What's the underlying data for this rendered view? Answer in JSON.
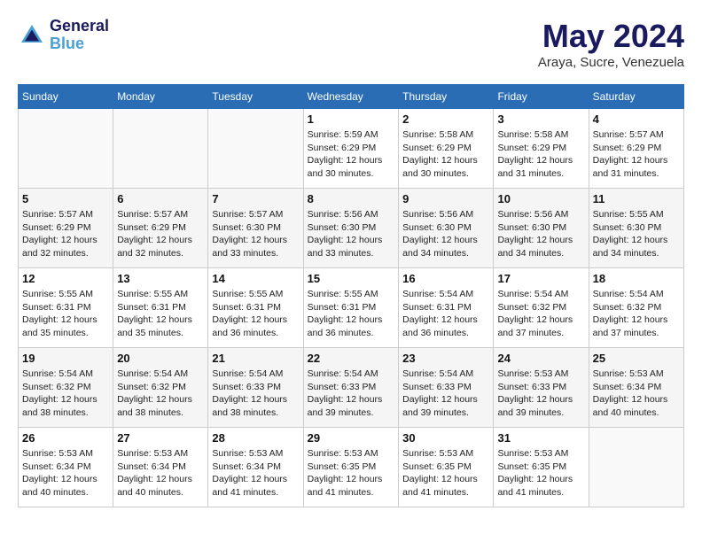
{
  "header": {
    "logo_line1": "General",
    "logo_line2": "Blue",
    "month_year": "May 2024",
    "location": "Araya, Sucre, Venezuela"
  },
  "days_of_week": [
    "Sunday",
    "Monday",
    "Tuesday",
    "Wednesday",
    "Thursday",
    "Friday",
    "Saturday"
  ],
  "weeks": [
    [
      {
        "day": "",
        "sunrise": "",
        "sunset": "",
        "daylight": ""
      },
      {
        "day": "",
        "sunrise": "",
        "sunset": "",
        "daylight": ""
      },
      {
        "day": "",
        "sunrise": "",
        "sunset": "",
        "daylight": ""
      },
      {
        "day": "1",
        "sunrise": "Sunrise: 5:59 AM",
        "sunset": "Sunset: 6:29 PM",
        "daylight": "Daylight: 12 hours and 30 minutes."
      },
      {
        "day": "2",
        "sunrise": "Sunrise: 5:58 AM",
        "sunset": "Sunset: 6:29 PM",
        "daylight": "Daylight: 12 hours and 30 minutes."
      },
      {
        "day": "3",
        "sunrise": "Sunrise: 5:58 AM",
        "sunset": "Sunset: 6:29 PM",
        "daylight": "Daylight: 12 hours and 31 minutes."
      },
      {
        "day": "4",
        "sunrise": "Sunrise: 5:57 AM",
        "sunset": "Sunset: 6:29 PM",
        "daylight": "Daylight: 12 hours and 31 minutes."
      }
    ],
    [
      {
        "day": "5",
        "sunrise": "Sunrise: 5:57 AM",
        "sunset": "Sunset: 6:29 PM",
        "daylight": "Daylight: 12 hours and 32 minutes."
      },
      {
        "day": "6",
        "sunrise": "Sunrise: 5:57 AM",
        "sunset": "Sunset: 6:29 PM",
        "daylight": "Daylight: 12 hours and 32 minutes."
      },
      {
        "day": "7",
        "sunrise": "Sunrise: 5:57 AM",
        "sunset": "Sunset: 6:30 PM",
        "daylight": "Daylight: 12 hours and 33 minutes."
      },
      {
        "day": "8",
        "sunrise": "Sunrise: 5:56 AM",
        "sunset": "Sunset: 6:30 PM",
        "daylight": "Daylight: 12 hours and 33 minutes."
      },
      {
        "day": "9",
        "sunrise": "Sunrise: 5:56 AM",
        "sunset": "Sunset: 6:30 PM",
        "daylight": "Daylight: 12 hours and 34 minutes."
      },
      {
        "day": "10",
        "sunrise": "Sunrise: 5:56 AM",
        "sunset": "Sunset: 6:30 PM",
        "daylight": "Daylight: 12 hours and 34 minutes."
      },
      {
        "day": "11",
        "sunrise": "Sunrise: 5:55 AM",
        "sunset": "Sunset: 6:30 PM",
        "daylight": "Daylight: 12 hours and 34 minutes."
      }
    ],
    [
      {
        "day": "12",
        "sunrise": "Sunrise: 5:55 AM",
        "sunset": "Sunset: 6:31 PM",
        "daylight": "Daylight: 12 hours and 35 minutes."
      },
      {
        "day": "13",
        "sunrise": "Sunrise: 5:55 AM",
        "sunset": "Sunset: 6:31 PM",
        "daylight": "Daylight: 12 hours and 35 minutes."
      },
      {
        "day": "14",
        "sunrise": "Sunrise: 5:55 AM",
        "sunset": "Sunset: 6:31 PM",
        "daylight": "Daylight: 12 hours and 36 minutes."
      },
      {
        "day": "15",
        "sunrise": "Sunrise: 5:55 AM",
        "sunset": "Sunset: 6:31 PM",
        "daylight": "Daylight: 12 hours and 36 minutes."
      },
      {
        "day": "16",
        "sunrise": "Sunrise: 5:54 AM",
        "sunset": "Sunset: 6:31 PM",
        "daylight": "Daylight: 12 hours and 36 minutes."
      },
      {
        "day": "17",
        "sunrise": "Sunrise: 5:54 AM",
        "sunset": "Sunset: 6:32 PM",
        "daylight": "Daylight: 12 hours and 37 minutes."
      },
      {
        "day": "18",
        "sunrise": "Sunrise: 5:54 AM",
        "sunset": "Sunset: 6:32 PM",
        "daylight": "Daylight: 12 hours and 37 minutes."
      }
    ],
    [
      {
        "day": "19",
        "sunrise": "Sunrise: 5:54 AM",
        "sunset": "Sunset: 6:32 PM",
        "daylight": "Daylight: 12 hours and 38 minutes."
      },
      {
        "day": "20",
        "sunrise": "Sunrise: 5:54 AM",
        "sunset": "Sunset: 6:32 PM",
        "daylight": "Daylight: 12 hours and 38 minutes."
      },
      {
        "day": "21",
        "sunrise": "Sunrise: 5:54 AM",
        "sunset": "Sunset: 6:33 PM",
        "daylight": "Daylight: 12 hours and 38 minutes."
      },
      {
        "day": "22",
        "sunrise": "Sunrise: 5:54 AM",
        "sunset": "Sunset: 6:33 PM",
        "daylight": "Daylight: 12 hours and 39 minutes."
      },
      {
        "day": "23",
        "sunrise": "Sunrise: 5:54 AM",
        "sunset": "Sunset: 6:33 PM",
        "daylight": "Daylight: 12 hours and 39 minutes."
      },
      {
        "day": "24",
        "sunrise": "Sunrise: 5:53 AM",
        "sunset": "Sunset: 6:33 PM",
        "daylight": "Daylight: 12 hours and 39 minutes."
      },
      {
        "day": "25",
        "sunrise": "Sunrise: 5:53 AM",
        "sunset": "Sunset: 6:34 PM",
        "daylight": "Daylight: 12 hours and 40 minutes."
      }
    ],
    [
      {
        "day": "26",
        "sunrise": "Sunrise: 5:53 AM",
        "sunset": "Sunset: 6:34 PM",
        "daylight": "Daylight: 12 hours and 40 minutes."
      },
      {
        "day": "27",
        "sunrise": "Sunrise: 5:53 AM",
        "sunset": "Sunset: 6:34 PM",
        "daylight": "Daylight: 12 hours and 40 minutes."
      },
      {
        "day": "28",
        "sunrise": "Sunrise: 5:53 AM",
        "sunset": "Sunset: 6:34 PM",
        "daylight": "Daylight: 12 hours and 41 minutes."
      },
      {
        "day": "29",
        "sunrise": "Sunrise: 5:53 AM",
        "sunset": "Sunset: 6:35 PM",
        "daylight": "Daylight: 12 hours and 41 minutes."
      },
      {
        "day": "30",
        "sunrise": "Sunrise: 5:53 AM",
        "sunset": "Sunset: 6:35 PM",
        "daylight": "Daylight: 12 hours and 41 minutes."
      },
      {
        "day": "31",
        "sunrise": "Sunrise: 5:53 AM",
        "sunset": "Sunset: 6:35 PM",
        "daylight": "Daylight: 12 hours and 41 minutes."
      },
      {
        "day": "",
        "sunrise": "",
        "sunset": "",
        "daylight": ""
      }
    ]
  ]
}
